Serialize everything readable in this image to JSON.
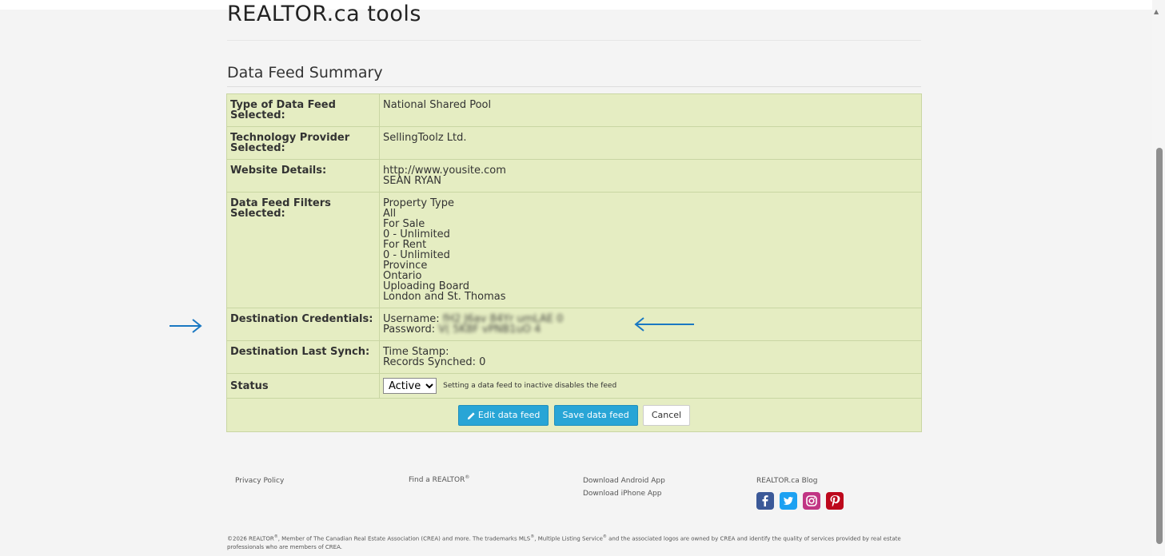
{
  "header": {
    "page_title": "REALTOR.ca tools"
  },
  "section": {
    "title": "Data Feed Summary"
  },
  "summary": {
    "type_label": "Type of Data Feed Selected:",
    "type_value": "National Shared Pool",
    "tech_label": "Technology Provider Selected:",
    "tech_value": "SellingToolz Ltd.",
    "website_label": "Website Details:",
    "website_lines": [
      "http://www.yousite.com",
      "SEAN RYAN"
    ],
    "filters_label": "Data Feed Filters Selected:",
    "filters_lines": [
      "Property Type",
      "All",
      "For Sale",
      "0 - Unlimited",
      "For Rent",
      "0 - Unlimited",
      "Province",
      "Ontario",
      "Uploading Board",
      "London and St. Thomas"
    ],
    "cred_label": "Destination Credentials:",
    "username_prefix": "Username: ",
    "username_value": "fH2 J6av 84Yr umLAE 0",
    "password_prefix": "Password: ",
    "password_value": "V( 5K8F vPNB1uO 4",
    "synch_label": "Destination Last Synch:",
    "synch_lines": [
      "Time Stamp:",
      "Records Synched: 0"
    ],
    "status_label": "Status",
    "status_selected": "Active",
    "status_note": "Setting a data feed to inactive disables the feed"
  },
  "buttons": {
    "edit": "Edit data feed",
    "save": "Save data feed",
    "cancel": "Cancel"
  },
  "footer": {
    "privacy": "Privacy Policy",
    "find_realtor": "Find a REALTOR",
    "find_realtor_mark": "®",
    "android": "Download Android App",
    "iphone": "Download iPhone App",
    "blog": "REALTOR.ca Blog",
    "copyright_1": "©2026 REALTOR",
    "copyright_mark": "®",
    "copyright_2": ", Member of The Canadian Real Estate Association (CREA) and more. The trademarks MLS",
    "copyright_3": ", Multiple Listing Service",
    "copyright_4": " and the associated logos are owned by CREA and identify the quality of services provided by real estate professionals who are members of CREA."
  },
  "social": [
    {
      "name": "facebook-icon",
      "color": "#3b5998"
    },
    {
      "name": "twitter-icon",
      "color": "#1da1f2"
    },
    {
      "name": "instagram-icon",
      "color": "#c13584"
    },
    {
      "name": "pinterest-icon",
      "color": "#bd081c"
    }
  ],
  "colors": {
    "table_bg": "#e5edc2",
    "accent_blue": "#28a5d6",
    "arrow_blue": "#1a78c2"
  }
}
